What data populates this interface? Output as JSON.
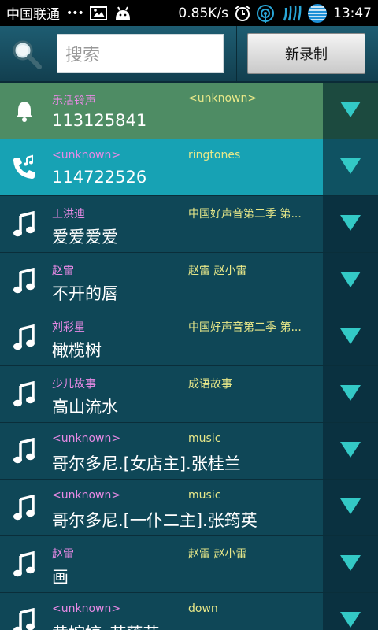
{
  "status_bar": {
    "carrier": "中国联通",
    "dots": "•••",
    "speed": "0.85K/s",
    "time": "13:47"
  },
  "toolbar": {
    "search_placeholder": "搜索",
    "record_button": "新录制"
  },
  "colors": {
    "artist": "#e98ae6",
    "album": "#e8e889",
    "expand_arrow": "#33c9c6",
    "row_highlight_green": "#4e8c64",
    "row_highlight_cyan": "#17a2b4",
    "row_default": "#0f4757"
  },
  "rows": [
    {
      "icon": "bell-icon",
      "artist": "乐活铃声",
      "album": "<unknown>",
      "title": "113125841",
      "highlight": "green"
    },
    {
      "icon": "phone-music-icon",
      "artist": "<unknown>",
      "album": "ringtones",
      "title": "114722526",
      "highlight": "cyan"
    },
    {
      "icon": "music-note-icon",
      "artist": "王洪迪",
      "album": "中国好声音第二季 第...",
      "title": "爱爱爱爱",
      "highlight": ""
    },
    {
      "icon": "music-note-icon",
      "artist": "赵雷",
      "album": "赵雷 赵小雷",
      "title": "不开的唇",
      "highlight": ""
    },
    {
      "icon": "music-note-icon",
      "artist": "刘彩星",
      "album": "中国好声音第二季 第...",
      "title": "橄榄树",
      "highlight": ""
    },
    {
      "icon": "music-note-icon",
      "artist": "少儿故事",
      "album": "成语故事",
      "title": "高山流水",
      "highlight": ""
    },
    {
      "icon": "music-note-icon",
      "artist": "<unknown>",
      "album": "music",
      "title": "哥尔多尼.[女店主].张桂兰",
      "highlight": ""
    },
    {
      "icon": "music-note-icon",
      "artist": "<unknown>",
      "album": "music",
      "title": "哥尔多尼.[一仆二主].张筠英",
      "highlight": ""
    },
    {
      "icon": "music-note-icon",
      "artist": "赵雷",
      "album": "赵雷 赵小雷",
      "title": "画",
      "highlight": ""
    },
    {
      "icon": "music-note-icon",
      "artist": "<unknown>",
      "album": "down",
      "title": "黄婉婷_苏落花",
      "highlight": ""
    }
  ]
}
